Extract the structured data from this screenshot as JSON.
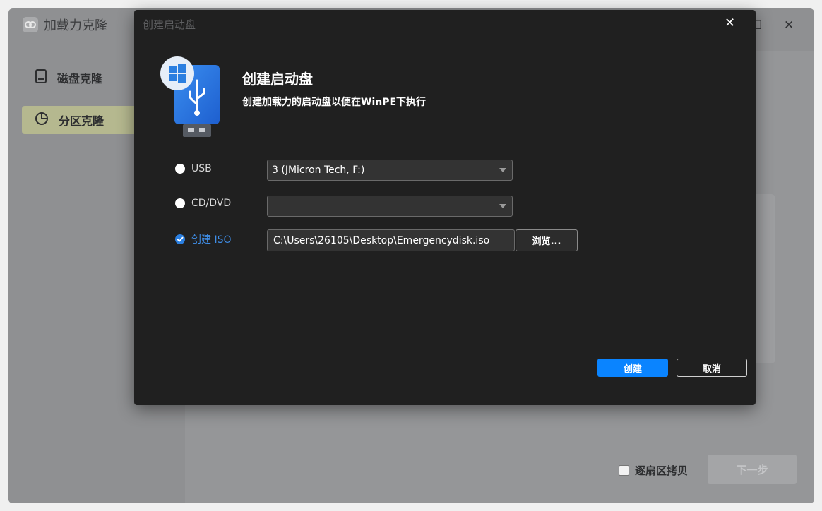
{
  "app": {
    "title": "加载力克隆",
    "sidebar": [
      {
        "label": "磁盘克隆",
        "icon": "disk-icon",
        "active": false
      },
      {
        "label": "分区克隆",
        "icon": "pie-chart-icon",
        "active": true
      }
    ],
    "sector_copy_label": "逐扇区拷贝",
    "next_label": "下一步"
  },
  "dialog": {
    "window_title": "创建启动盘",
    "heading": "创建启动盘",
    "subtitle": "创建加载力的启动盘以便在WinPE下执行",
    "options": {
      "usb": {
        "label": "USB",
        "selected_value": "3 (JMicron Tech, F:)",
        "checked": false
      },
      "cd": {
        "label": "CD/DVD",
        "selected_value": "",
        "checked": false
      },
      "iso": {
        "label": "创建 ISO",
        "path": "C:\\Users\\26105\\Desktop\\Emergencydisk.iso",
        "checked": true
      }
    },
    "browse_label": "浏览...",
    "create_label": "创建",
    "cancel_label": "取消"
  },
  "colors": {
    "accent": "#0a84ff",
    "dialog_bg": "#202020",
    "selected_text": "#3f8ee8"
  }
}
